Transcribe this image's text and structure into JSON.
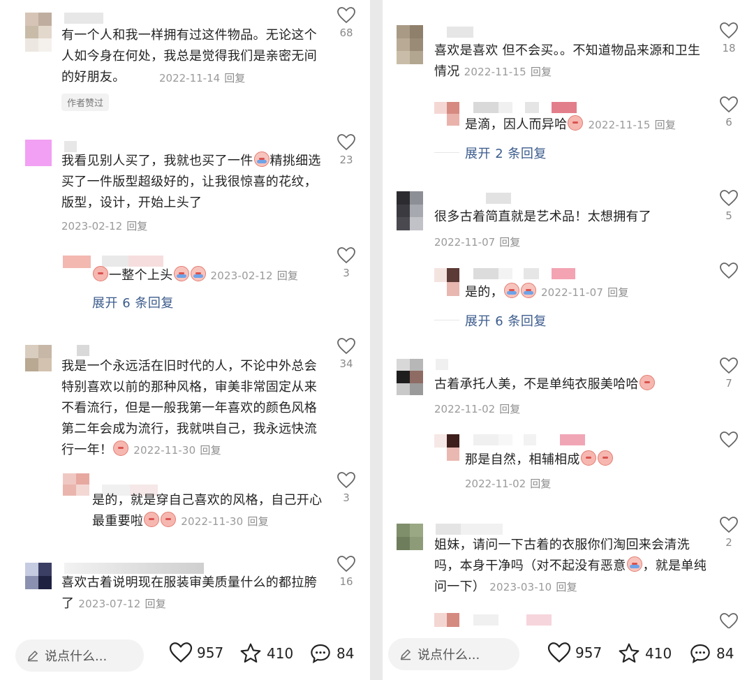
{
  "left": {
    "comments": [
      {
        "text": "有一个人和我一样拥有过这件物品。无论这个人如今身在何处，我总是觉得我们是亲密无间的好朋友。",
        "date": "2022-11-14",
        "reply": "回复",
        "likes": "68",
        "badge": "作者赞过"
      },
      {
        "text_a": "我看见别人买了，我就也买了一件",
        "text_b": "精挑细选买了一件版型超级好的，让我很惊喜的花纹，版型，设计，开始上头了",
        "date": "2023-02-12",
        "reply": "回复",
        "likes": "23"
      },
      {
        "text": "一整个上头",
        "date": "2023-02-12",
        "reply": "回复",
        "likes": "3",
        "expand": "展开 6 条回复"
      },
      {
        "text": "我是一个永远活在旧时代的人，不论中外总会特别喜欢以前的那种风格，审美非常固定从来不看流行，但是一般我第一年喜欢的颜色风格第二年会成为流行，我就哄自己，我永远快流行一年！",
        "date": "2022-11-30",
        "reply": "回复",
        "likes": "34"
      },
      {
        "text": "是的，就是穿自己喜欢的风格，自己开心最重要啦",
        "date": "2022-11-30",
        "reply": "回复",
        "likes": "3"
      },
      {
        "text": "喜欢古着说明现在服装审美质量什么的都拉胯了",
        "date": "2023-07-12",
        "reply": "回复",
        "likes": "16"
      }
    ],
    "bar": {
      "placeholder": "说点什么...",
      "likes": "957",
      "stars": "410",
      "comments": "84"
    }
  },
  "right": {
    "comments": [
      {
        "text": "喜欢是喜欢 但不会买。。不知道物品来源和卫生情况",
        "date": "2022-11-15",
        "reply": "回复",
        "likes": "18"
      },
      {
        "text": "是滴，因人而异哈",
        "date": "2022-11-15",
        "reply": "回复",
        "likes": "6",
        "expand": "展开 2 条回复"
      },
      {
        "text": "很多古着简直就是艺术品！太想拥有了",
        "date": "2022-11-07",
        "reply": "回复",
        "likes": "5"
      },
      {
        "text": "是的，",
        "date": "2022-11-07",
        "reply": "回复",
        "likes": "",
        "expand": "展开 6 条回复"
      },
      {
        "text": "古着承托人美，不是单纯衣服美哈哈",
        "date": "2022-11-02",
        "reply": "回复",
        "likes": "7"
      },
      {
        "text": "那是自然，相辅相成",
        "date": "2022-11-02",
        "reply": "回复",
        "likes": ""
      },
      {
        "text": "姐妹，请问一下古着的衣服你们淘回来会清洗吗，本身干净吗（对不起没有恶意",
        "text_b": "，就是单纯问一下）",
        "date": "2023-03-10",
        "reply": "回复",
        "likes": "2"
      }
    ],
    "bar": {
      "placeholder": "说点什么...",
      "likes": "957",
      "stars": "410",
      "comments": "84"
    }
  },
  "colors": {
    "link": "#3b5b8c",
    "meta": "#9a9a9a",
    "text": "#222222"
  }
}
